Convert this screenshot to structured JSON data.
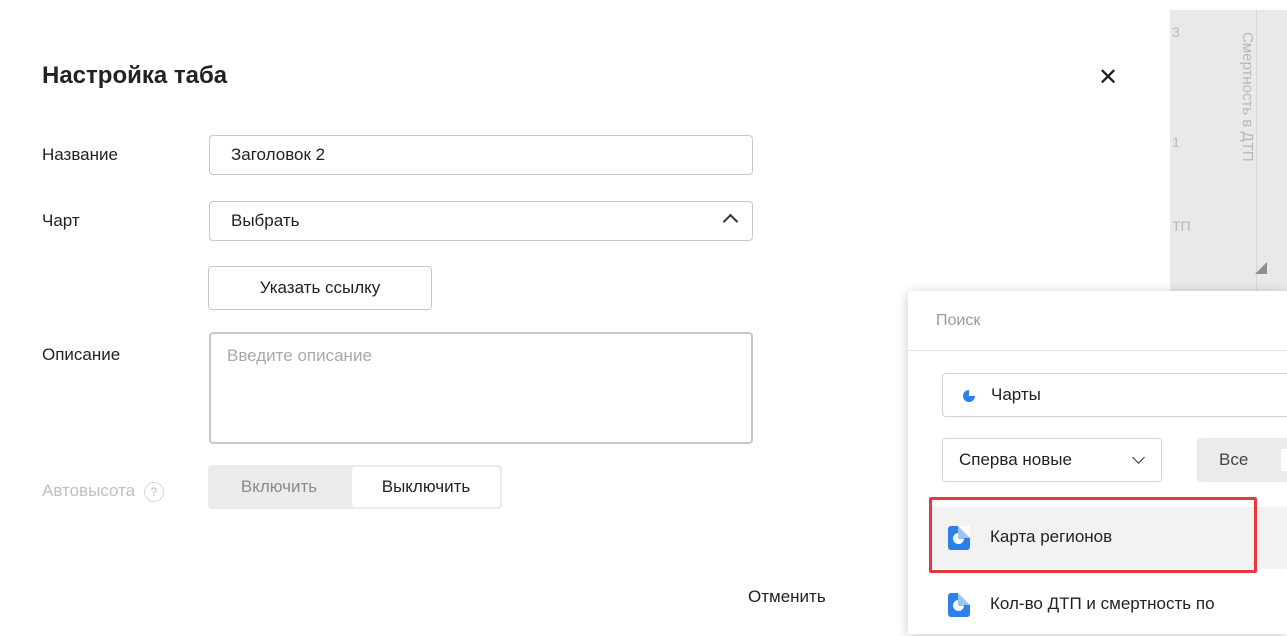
{
  "background": {
    "column_header": "Смертность в ДТП",
    "fragment_top": "3",
    "fragment_mid": "1",
    "fragment_bottom": "ТП"
  },
  "dialog": {
    "title": "Настройка таба",
    "name_label": "Название",
    "name_value": "Заголовок 2",
    "chart_label": "Чарт",
    "chart_value": "Выбрать",
    "link_button": "Указать ссылку",
    "description_label": "Описание",
    "description_placeholder": "Введите описание",
    "autoheight_label": "Автовысота",
    "help_glyph": "?",
    "autoheight_on": "Включить",
    "autoheight_off": "Выключить",
    "cancel_button": "Отменить",
    "close_glyph": "✕"
  },
  "popup": {
    "search_placeholder": "Поиск",
    "type_filter": "Чарты",
    "sort": "Сперва новые",
    "filter_all": "Все",
    "items": [
      {
        "label": "Карта регионов",
        "selected": true
      },
      {
        "label": "Кол-во ДТП и смертность по",
        "selected": false
      }
    ]
  },
  "colors": {
    "accent_blue": "#2f7fe8",
    "highlight_red": "#e8373f"
  }
}
